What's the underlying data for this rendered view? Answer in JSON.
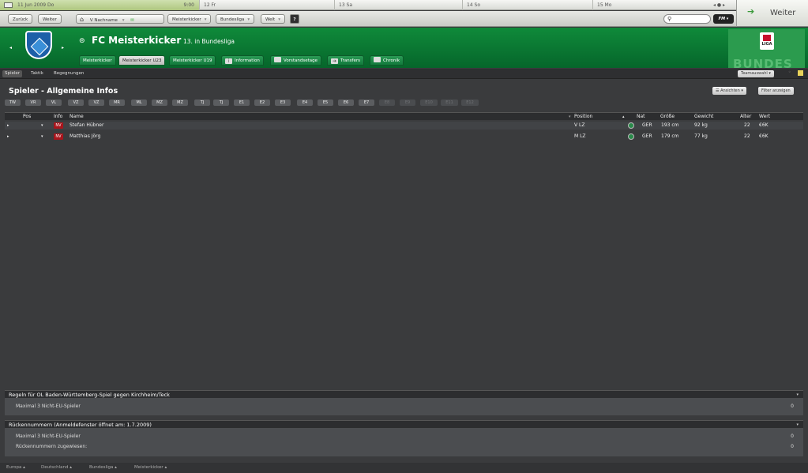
{
  "calendar": {
    "today_date": "11 Jun 2009 Do",
    "today_time": "9:00",
    "days": [
      "12 Fr",
      "13 Sa",
      "14 So",
      "15 Mo"
    ],
    "nav_glyphs": "◂ ● ▸"
  },
  "nav": {
    "back": "Zurück",
    "forward": "Weiter",
    "home_label": "V Nachname",
    "club": "Meisterkicker",
    "league": "Bundesliga",
    "world": "Welt",
    "help": "?",
    "search_placeholder": "",
    "fm_label": "FM",
    "continue_label": "Weiter"
  },
  "club": {
    "name": "FC Meisterkicker",
    "position": "13. in Bundesliga",
    "tabs": [
      "Meisterkicker",
      "Meisterkicker U23",
      "Meisterkicker U19",
      "Information",
      "Vorstandsetage",
      "Transfers",
      "Chronik"
    ],
    "active_tab": "Meisterkicker U23",
    "logo_badge": "LIGA",
    "logo_word": "BUNDES"
  },
  "subnav": {
    "tabs": [
      "Spieler",
      "Taktik",
      "Begegnungen"
    ],
    "active": "Spieler",
    "team_select": "Teamauswahl"
  },
  "page": {
    "title": "Spieler - Allgemeine Infos",
    "views_button": "Ansichten",
    "filter_button": "Filter anzeigen",
    "filters": [
      "TW",
      "VR",
      "VL",
      "VZ",
      "VZ",
      "MR",
      "ML",
      "MZ",
      "MZ",
      "TJ",
      "TJ",
      "E1",
      "E2",
      "E3",
      "E4",
      "E5",
      "E6",
      "E7",
      "E8",
      "E9",
      "E10",
      "E11",
      "E12"
    ]
  },
  "table": {
    "headers": {
      "pos": "Pos",
      "info": "Info",
      "name": "Name",
      "position": "Position",
      "nat": "Nat",
      "height": "Größe",
      "weight": "Gewicht",
      "age": "Alter",
      "value": "Wert"
    },
    "rows": [
      {
        "info": "NV",
        "name": "Stefan Hübner",
        "position": "V LZ",
        "nat": "GER",
        "height": "193 cm",
        "weight": "92 kg",
        "age": "22",
        "value": "€6K"
      },
      {
        "info": "NV",
        "name": "Matthias Jörg",
        "position": "M LZ",
        "nat": "GER",
        "height": "179 cm",
        "weight": "77 kg",
        "age": "22",
        "value": "€6K"
      }
    ]
  },
  "rules": {
    "title": "Regeln für OL Baden-Württemberg-Spiel gegen Kirchheim/Teck",
    "rows": [
      {
        "label": "Maximal 3 Nicht-EU-Spieler",
        "value": "0"
      }
    ]
  },
  "numbers": {
    "title": "Rückennummern (Anmeldefenster öffnet am: 1.7.2009)",
    "rows": [
      {
        "label": "Maximal 3 Nicht-EU-Spieler",
        "value": "0"
      },
      {
        "label": "Rückennummern zugewiesen:",
        "value": "0"
      }
    ]
  },
  "breadcrumb": [
    "Europa",
    "Deutschland",
    "Bundesliga",
    "Meisterkicker"
  ],
  "colors": {
    "header_green": "#0f8a3a",
    "nv_red": "#a8151c",
    "background": "#3a3b3d"
  }
}
